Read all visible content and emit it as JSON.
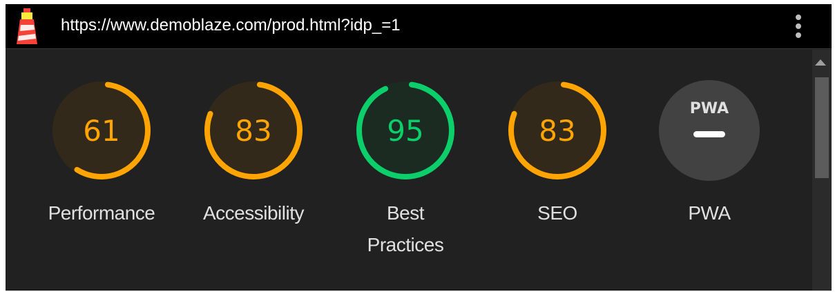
{
  "topbar": {
    "url": "https://www.demoblaze.com/prod.html?idp_=1",
    "logo_icon": "lighthouse-icon",
    "menu_icon": "more-vert-icon"
  },
  "colors": {
    "average": "#ffa400",
    "average_bg": "#33291a",
    "pass": "#0cce6b",
    "pass_bg": "#1b2b22",
    "pwa_bg": "#424242",
    "pwa_fg": "#e0e0e0"
  },
  "gauges": [
    {
      "label": "Performance",
      "score": "61",
      "status": "average"
    },
    {
      "label": "Accessibility",
      "score": "83",
      "status": "average"
    },
    {
      "label": "Best Practices",
      "label_line1": "Best",
      "label_line2": "Practices",
      "score": "95",
      "status": "pass"
    },
    {
      "label": "SEO",
      "score": "83",
      "status": "average"
    },
    {
      "label": "PWA",
      "badge": "PWA",
      "status": "not-applicable",
      "icon": "pwa-badge-icon"
    }
  ]
}
